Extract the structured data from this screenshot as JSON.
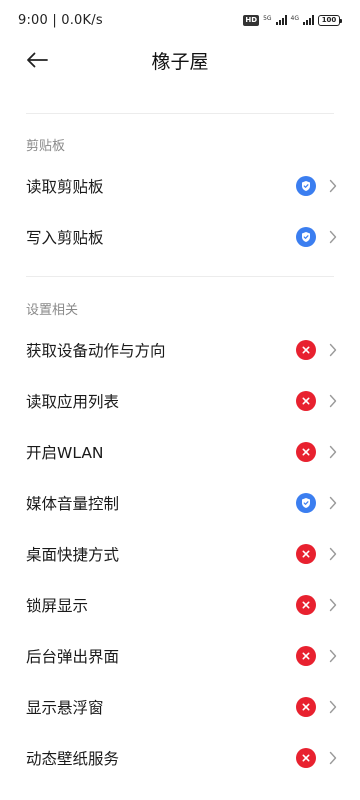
{
  "status_bar": {
    "time_speed": "9:00 | 0.0K/s",
    "hd": "HD",
    "net1": "5G",
    "net2": "4G",
    "battery": "100"
  },
  "header": {
    "title": "橡子屋"
  },
  "sections": [
    {
      "title": "剪贴板",
      "items": [
        {
          "label": "读取剪贴板",
          "status": "allowed"
        },
        {
          "label": "写入剪贴板",
          "status": "allowed"
        }
      ]
    },
    {
      "title": "设置相关",
      "items": [
        {
          "label": "获取设备动作与方向",
          "status": "denied"
        },
        {
          "label": "读取应用列表",
          "status": "denied"
        },
        {
          "label": "开启WLAN",
          "status": "denied"
        },
        {
          "label": "媒体音量控制",
          "status": "allowed"
        },
        {
          "label": "桌面快捷方式",
          "status": "denied"
        },
        {
          "label": "锁屏显示",
          "status": "denied"
        },
        {
          "label": "后台弹出界面",
          "status": "denied"
        },
        {
          "label": "显示悬浮窗",
          "status": "denied"
        },
        {
          "label": "动态壁纸服务",
          "status": "denied"
        }
      ]
    }
  ],
  "colors": {
    "allowed": "#3b7ef0",
    "denied": "#e8212f"
  },
  "icons": {
    "allowed": "check-shield-icon",
    "denied": "x-icon",
    "row_arrow": "chevron-right-icon",
    "back": "arrow-left-icon"
  }
}
